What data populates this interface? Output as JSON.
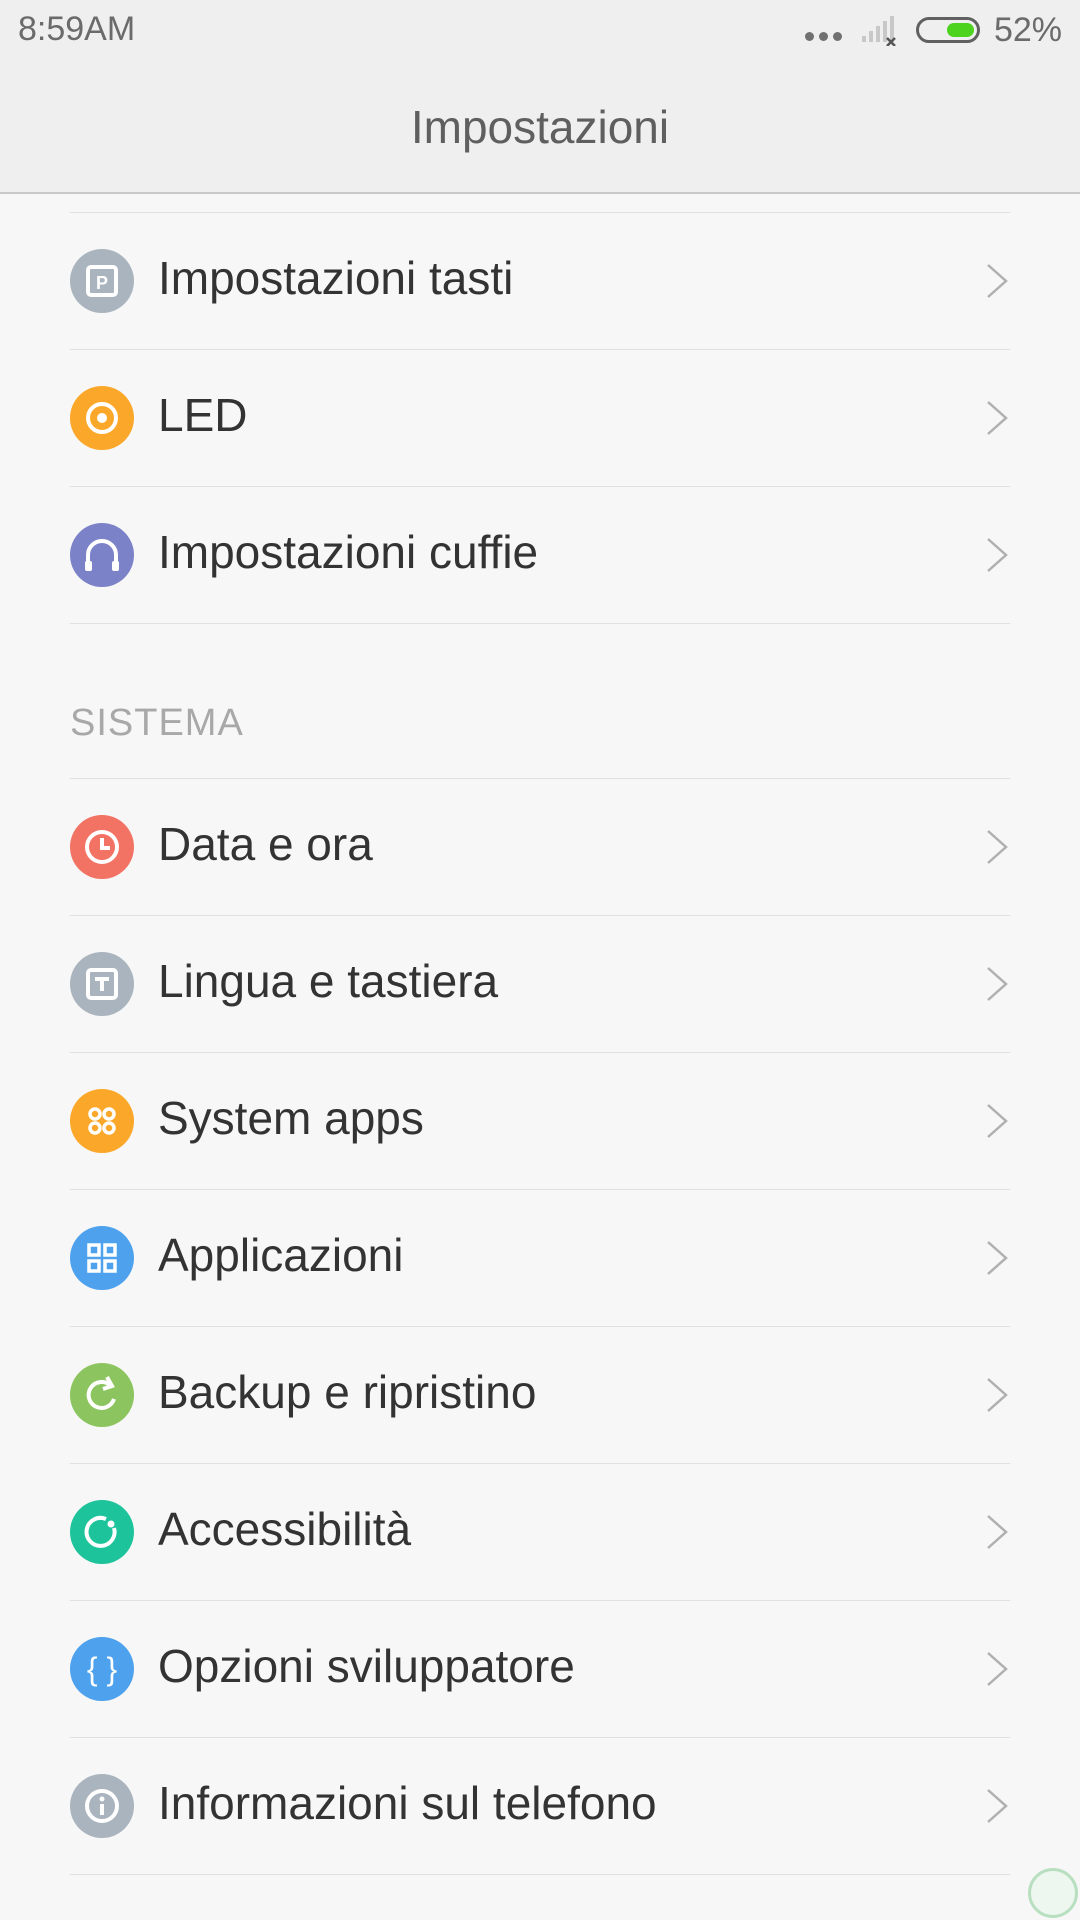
{
  "status_bar": {
    "time": "8:59AM",
    "battery_percent": "52%",
    "battery_level": 0.52,
    "battery_color": "#4bd31e"
  },
  "header": {
    "title": "Impostazioni"
  },
  "groups": {
    "top": [
      {
        "label": "Impostazioni tasti",
        "icon": "button-settings-icon",
        "color": "#a9b4be"
      },
      {
        "label": "LED",
        "icon": "led-icon",
        "color": "#fba72a"
      },
      {
        "label": "Impostazioni cuffie",
        "icon": "headphones-icon",
        "color": "#7b82c7"
      }
    ],
    "sistema_header": "SISTEMA",
    "sistema": [
      {
        "label": "Data e ora",
        "icon": "clock-icon",
        "color": "#f27264"
      },
      {
        "label": "Lingua e tastiera",
        "icon": "keyboard-icon",
        "color": "#a9b4be"
      },
      {
        "label": "System apps",
        "icon": "system-apps-icon",
        "color": "#fba72a"
      },
      {
        "label": "Applicazioni",
        "icon": "apps-grid-icon",
        "color": "#4ea1ec"
      },
      {
        "label": "Backup e ripristino",
        "icon": "backup-icon",
        "color": "#8cc55f"
      },
      {
        "label": "Accessibilità",
        "icon": "accessibility-icon",
        "color": "#1dc39a"
      },
      {
        "label": "Opzioni sviluppatore",
        "icon": "braces-icon",
        "color": "#4ea1ec"
      },
      {
        "label": "Informazioni sul telefono",
        "icon": "info-icon",
        "color": "#a9b4be"
      }
    ]
  }
}
